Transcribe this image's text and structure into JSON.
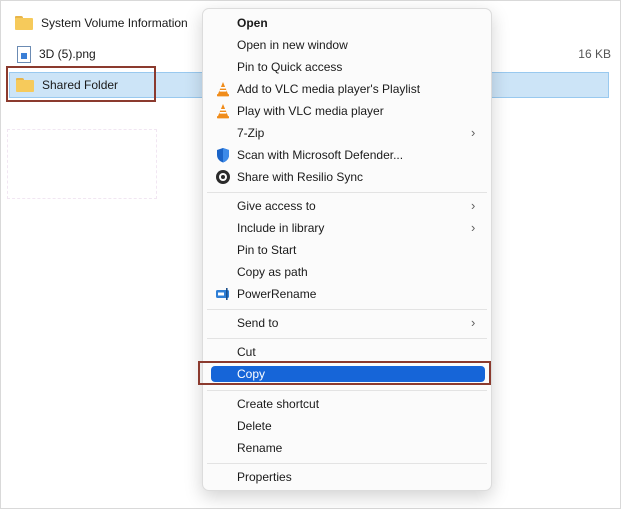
{
  "files": [
    {
      "name": "System Volume Information",
      "size": "",
      "type": "folder"
    },
    {
      "name": "3D (5).png",
      "size": "16 KB",
      "type": "file"
    },
    {
      "name": "Shared Folder",
      "size": "",
      "type": "folder",
      "selected": true
    }
  ],
  "menu": {
    "group1": [
      {
        "label": "Open",
        "bold": true
      },
      {
        "label": "Open in new window"
      },
      {
        "label": "Pin to Quick access"
      },
      {
        "label": "Add to VLC media player's Playlist",
        "icon": "vlc-icon"
      },
      {
        "label": "Play with VLC media player",
        "icon": "vlc-icon"
      },
      {
        "label": "7-Zip",
        "submenu": true
      },
      {
        "label": "Scan with Microsoft Defender...",
        "icon": "defender-icon"
      },
      {
        "label": "Share with Resilio Sync",
        "icon": "resilio-icon"
      }
    ],
    "group2": [
      {
        "label": "Give access to",
        "submenu": true
      },
      {
        "label": "Include in library",
        "submenu": true
      },
      {
        "label": "Pin to Start"
      },
      {
        "label": "Copy as path"
      },
      {
        "label": "PowerRename",
        "icon": "powerrename-icon"
      }
    ],
    "group3": [
      {
        "label": "Send to",
        "submenu": true
      }
    ],
    "group4": [
      {
        "label": "Cut"
      },
      {
        "label": "Copy",
        "active": true
      }
    ],
    "group5": [
      {
        "label": "Create shortcut"
      },
      {
        "label": "Delete"
      },
      {
        "label": "Rename"
      }
    ],
    "group6": [
      {
        "label": "Properties"
      }
    ]
  },
  "colors": {
    "selection": "#cce4f7",
    "menu_active": "#1665d8",
    "highlight_border": "#8b3a2e"
  }
}
